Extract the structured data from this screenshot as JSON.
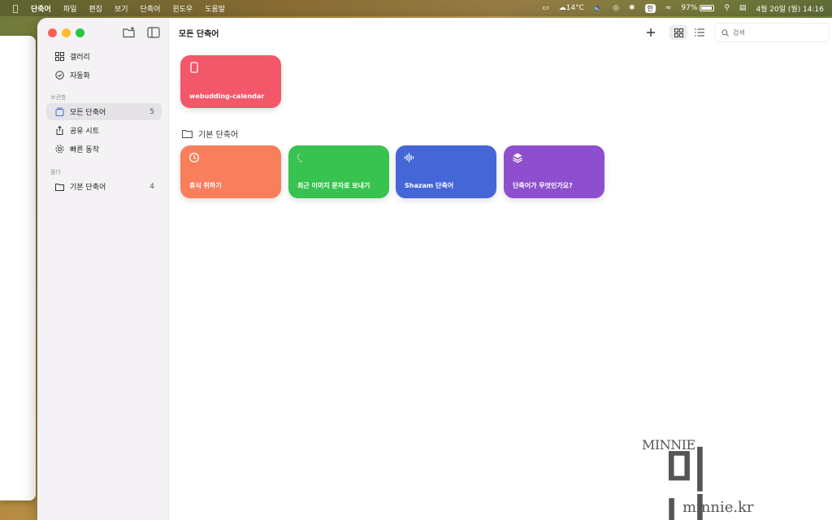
{
  "menubar": {
    "app": "단축어",
    "items": [
      "파일",
      "편집",
      "보기",
      "단축어",
      "윈도우",
      "도움말"
    ],
    "weather": "14°C",
    "input_method": "한",
    "battery": "97%",
    "datetime": "4월 20일 (월) 14:16"
  },
  "sidebar": {
    "top_items": [
      {
        "label": "갤러리",
        "icon": "grid-icon"
      },
      {
        "label": "자동화",
        "icon": "clock-check-icon"
      }
    ],
    "library_header": "보관함",
    "library_items": [
      {
        "label": "모든 단축어",
        "count": "5",
        "icon": "stack-icon",
        "selected": true
      },
      {
        "label": "공유 시트",
        "icon": "share-icon"
      },
      {
        "label": "빠른 동작",
        "icon": "gear-icon"
      }
    ],
    "folders_header": "폴더",
    "folder_items": [
      {
        "label": "기본 단축어",
        "count": "4",
        "icon": "folder-icon"
      }
    ]
  },
  "main": {
    "title": "모든 단축어",
    "search_placeholder": "검색",
    "top_cards": [
      {
        "label": "webudding-calendar",
        "color": "#f2576a",
        "icon": "phone-icon"
      }
    ],
    "folder_title": "기본 단축어",
    "folder_cards": [
      {
        "label": "휴식 취하기",
        "color": "#f97e5b",
        "icon": "timer-icon"
      },
      {
        "label": "최근 이미지 문자로 보내기",
        "color": "#38c24f",
        "icon": "message-plus-icon"
      },
      {
        "label": "Shazam 단축어",
        "color": "#4566d6",
        "icon": "waveform-icon"
      },
      {
        "label": "단축어가 무엇인가요?",
        "color": "#8e4fce",
        "icon": "layers-icon"
      }
    ]
  },
  "watermark": {
    "en": "MINNIE",
    "ko": "미니",
    "url": "minnie.kr"
  }
}
